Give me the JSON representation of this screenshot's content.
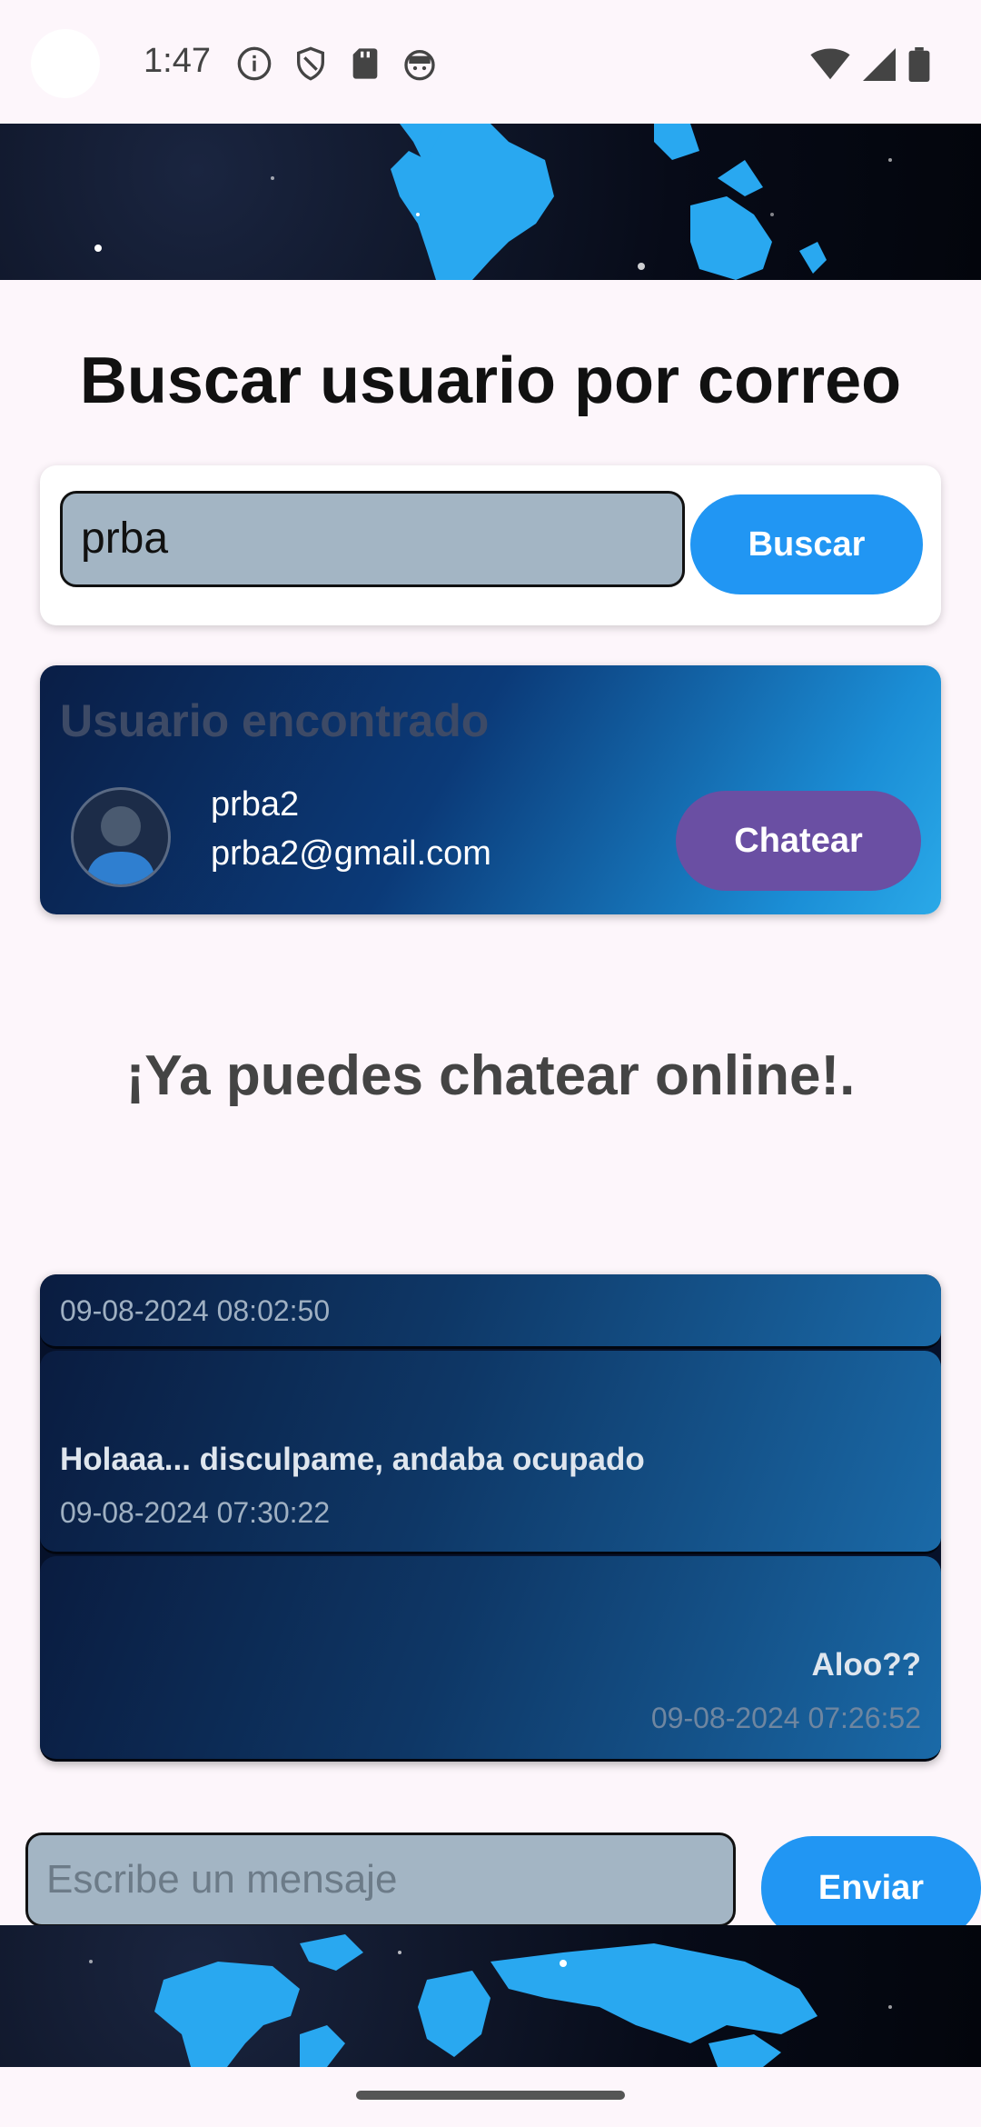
{
  "status_bar": {
    "time": "1:47",
    "left_icons": [
      "info-icon",
      "shield-icon",
      "sd-card-icon",
      "android-face-icon"
    ],
    "right_icons": [
      "wifi-icon",
      "signal-icon",
      "battery-icon"
    ]
  },
  "header": {
    "title": "Buscar usuario por correo"
  },
  "search": {
    "value": "prba",
    "button_label": "Buscar"
  },
  "found_user": {
    "title": "Usuario encontrado",
    "name": "prba2",
    "email": "prba2@gmail.com",
    "chat_button_label": "Chatear"
  },
  "online_message": "¡Ya puedes chatear online!.",
  "messages": [
    {
      "text": "",
      "timestamp": "09-08-2024 08:02:50",
      "side": "left"
    },
    {
      "text": "Holaaa... disculpame, andaba ocupado",
      "timestamp": "09-08-2024 07:30:22",
      "side": "left"
    },
    {
      "text": "Aloo??",
      "timestamp": "09-08-2024 07:26:52",
      "side": "right"
    }
  ],
  "composer": {
    "placeholder": "Escribe un mensaje",
    "send_label": "Enviar"
  },
  "colors": {
    "primary_button": "#2196f3",
    "chat_button": "#6a4fa3",
    "input_fill": "#a3b5c4",
    "background": "#fdf6fb"
  }
}
